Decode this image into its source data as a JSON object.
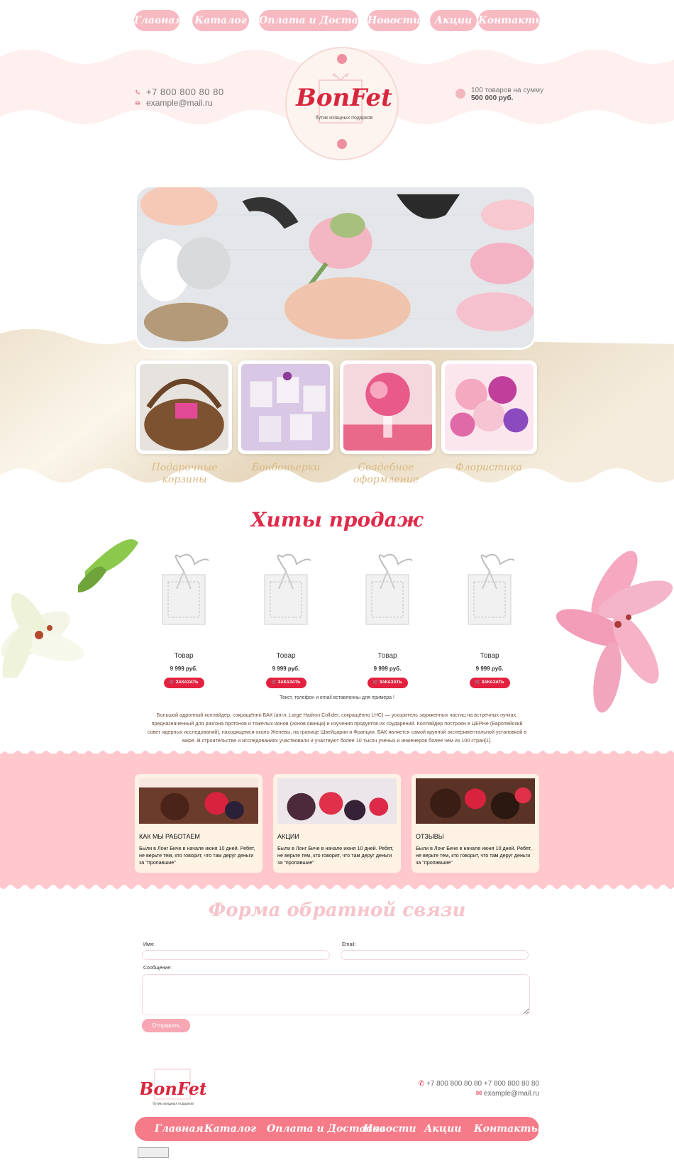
{
  "nav": {
    "items": [
      "Главная",
      "Каталог",
      "Оплата и Доставка",
      "Новости",
      "Акции",
      "Контакты"
    ]
  },
  "header": {
    "phone": "+7 800 800 80 80",
    "email": "example@mail.ru",
    "logo_text": "BonFet",
    "logo_sub": "бутик изящных подарков",
    "promo_line1": "100 товаров на сумму",
    "promo_line2": "500 000 руб."
  },
  "categories": [
    {
      "label": "Подарочные корзины"
    },
    {
      "label": "Бонбоньерки"
    },
    {
      "label": "Свадебное оформление"
    },
    {
      "label": "Флористика"
    }
  ],
  "hits": {
    "title": "Хиты продаж",
    "products": [
      {
        "name": "Товар",
        "price": "9 999 руб.",
        "button": "ЗАКАЗАТЬ"
      },
      {
        "name": "Товар",
        "price": "9 999 руб.",
        "button": "ЗАКАЗАТЬ"
      },
      {
        "name": "Товар",
        "price": "9 999 руб.",
        "button": "ЗАКАЗАТЬ"
      },
      {
        "name": "Товар",
        "price": "9 999 руб.",
        "button": "ЗАКАЗАТЬ"
      }
    ],
    "note": "Текст, телефон и email вставленны для примера !",
    "description": "Большой адронный коллайдер, сокращённо БАК (англ. Large Hadron Collider, сокращённо LHC) — ускоритель заряженных частиц на встречных пучках, предназначенный для разгона протонов и тяжёлых ионов (ионов свинца) и изучения продуктов их соударений. Коллайдер построен в ЦЕРНе (Европейский совет ядерных исследований), находящемся около Женевы, на границе Швейцарии и Франции. БАК является самой крупной экспериментальной установкой в мире. В строительстве и исследованиях участвовали и участвуют более 10 тысяч учёных и инженеров более чем из 100 стран[1]."
  },
  "info_cards": [
    {
      "title": "КАК МЫ РАБОТАЕМ",
      "text": "Были в Лонг Биче в начале июня 10 дней. Ребят, не верьте тем, кто говорит, что там деруг деньги за \"пропавшие\""
    },
    {
      "title": "АКЦИИ",
      "text": "Были в Лонг Биче в начале июня 10 дней. Ребят, не верьте тем, кто говорит, что там деруг деньги за \"пропавшие\""
    },
    {
      "title": "ОТЗЫВЫ",
      "text": "Были в Лонг Биче в начале июня 10 дней. Ребят, не верьте тем, кто говорит, что там деруг деньги за \"пропавшие\""
    }
  ],
  "form": {
    "title": "Форма обратной связи",
    "name_label": "Имя:",
    "email_label": "Email:",
    "message_label": "Сообщение:",
    "submit": "Отправить"
  },
  "footer": {
    "phones": "+7 800 800 80 80   +7 800 800 80 80",
    "email": "example@mail.ru",
    "logo_text": "BonFet",
    "logo_sub": "бутик изящных подарков",
    "nav": [
      "Главная",
      "Каталог",
      "Оплата и Доставка",
      "Новости",
      "Акции",
      "Контакты"
    ]
  },
  "colors": {
    "pink": "#f7b9c2",
    "red": "#e3213f",
    "cream": "#f6ecdc",
    "band_pink": "#ffc8cd"
  }
}
